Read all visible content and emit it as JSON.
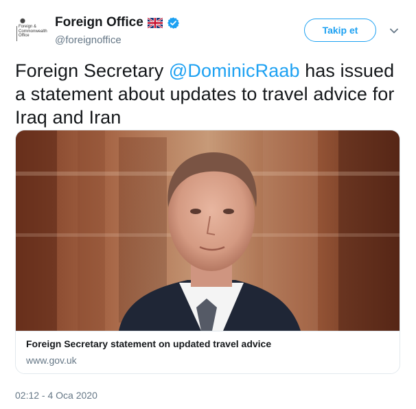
{
  "account": {
    "display_name": "Foreign Office",
    "handle": "@foreignoffice",
    "avatar_text": "Foreign &\nCommonwealth\nOffice"
  },
  "header": {
    "follow_label": "Takip et"
  },
  "tweet": {
    "text_before": "Foreign Secretary ",
    "mention": "@DominicRaab",
    "text_after": " has issued a statement about updates to travel advice for Iraq and Iran",
    "timestamp": "02:12 - 4 Oca 2020"
  },
  "card": {
    "title": "Foreign Secretary statement on updated travel advice",
    "domain": "www.gov.uk"
  },
  "icons": {
    "flag": "uk-flag-icon",
    "verified": "verified-badge-icon",
    "caret": "chevron-down-icon"
  },
  "colors": {
    "accent": "#1da1f2",
    "secondary_text": "#657786",
    "primary_text": "#14171a"
  }
}
